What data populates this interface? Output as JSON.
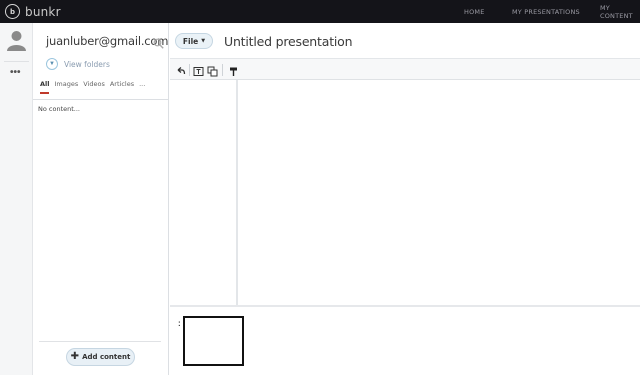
{
  "app": {
    "brand": "bunkr",
    "logo_glyph": "b"
  },
  "nav": {
    "home": "HOME",
    "presentations": "MY PRESENTATIONS",
    "content": "MY CONTENT"
  },
  "rail": {
    "more": "•••"
  },
  "sidebar": {
    "user_email": "juanluber@gmail.com",
    "view_folders": "View folders",
    "tabs": [
      "All",
      "Images",
      "Videos",
      "Articles",
      "..."
    ],
    "active_tab": "All",
    "empty_text": "No content...",
    "add_content": "Add content"
  },
  "editor": {
    "file_label": "File",
    "title": "Untitled presentation",
    "toolbar_icons": [
      "undo-icon",
      "text-frame-icon",
      "layers-icon",
      "paint-roller-icon"
    ]
  },
  "slides": {
    "thumbs": [
      {
        "number": ":"
      }
    ]
  },
  "colors": {
    "topbar": "#141419",
    "active_tab_underline": "#c0392b",
    "button_bg": "#eaf2f7"
  }
}
